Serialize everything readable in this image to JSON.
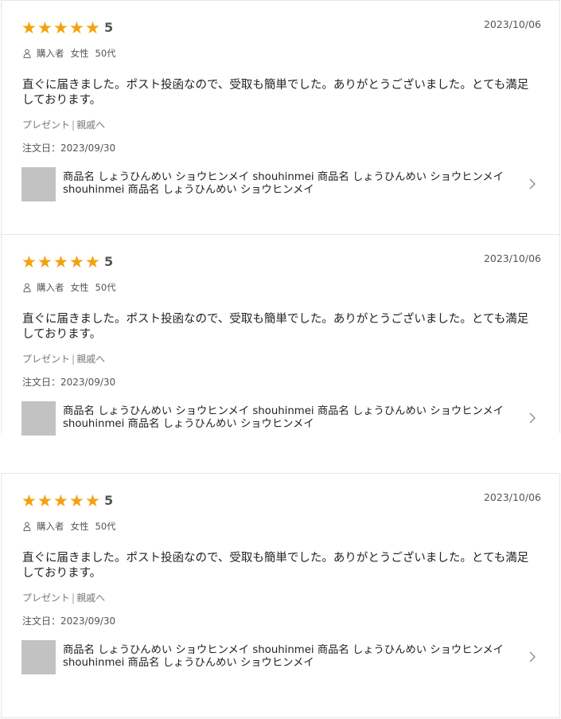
{
  "reviews": [
    {
      "rating": "5",
      "date": "2023/10/06",
      "reviewer": "購入者",
      "gender": "女性",
      "age": "50代",
      "text": "直ぐに届きました。ポスト投函なので、受取も簡単でした。ありがとうございました。とても満足しております。",
      "tag1": "プレゼント",
      "tag_sep": "|",
      "tag2": "親戚へ",
      "order_date": "注文日：2023/09/30",
      "product_name": "商品名 しょうひんめい ショウヒンメイ shouhinmei 商品名 しょうひんめい ショウヒンメイ shouhinmei 商品名 しょうひんめい ショウヒンメイ"
    },
    {
      "rating": "5",
      "date": "2023/10/06",
      "reviewer": "購入者",
      "gender": "女性",
      "age": "50代",
      "text": "直ぐに届きました。ポスト投函なので、受取も簡単でした。ありがとうございました。とても満足しております。",
      "tag1": "プレゼント",
      "tag_sep": "|",
      "tag2": "親戚へ",
      "order_date": "注文日：2023/09/30",
      "product_name": "商品名 しょうひんめい ショウヒンメイ shouhinmei 商品名 しょうひんめい ショウヒンメイ shouhinmei 商品名 しょうひんめい ショウヒンメイ"
    },
    {
      "rating": "5",
      "date": "2023/10/06",
      "reviewer": "購入者",
      "gender": "女性",
      "age": "50代",
      "text": "直ぐに届きました。ポスト投函なので、受取も簡単でした。ありがとうございました。とても満足しております。",
      "tag1": "プレゼント",
      "tag_sep": "|",
      "tag2": "親戚へ",
      "order_date": "注文日：2023/09/30",
      "product_name": "商品名 しょうひんめい ショウヒンメイ shouhinmei 商品名 しょうひんめい ショウヒンメイ shouhinmei 商品名 しょうひんめい ショウヒンメイ"
    }
  ],
  "icons": {
    "star": "star-icon",
    "person": "person-icon",
    "chevron": "chevron-right-icon"
  },
  "colors": {
    "star": "#f2a20c",
    "thumbnail": "#c2c2c2"
  }
}
